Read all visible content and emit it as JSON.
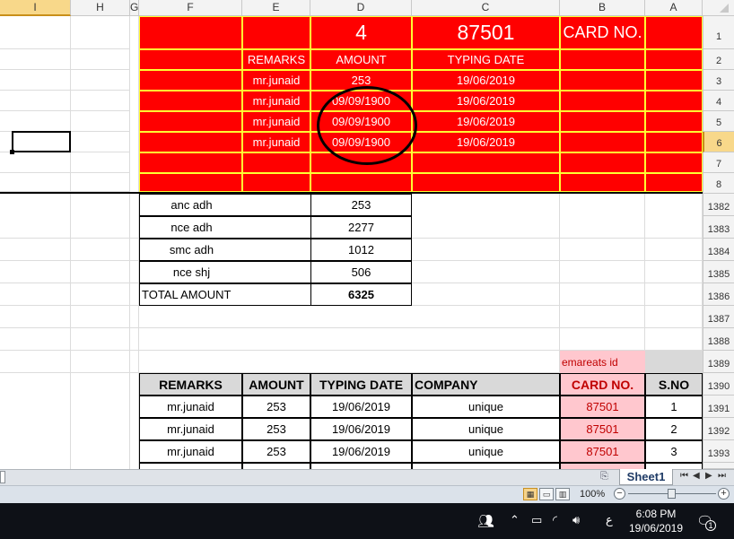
{
  "columns": {
    "i": "I",
    "h": "H",
    "g": "G",
    "f": "F",
    "e": "E",
    "d": "D",
    "c": "C",
    "b": "B",
    "a": "A"
  },
  "rows": [
    "1",
    "2",
    "3",
    "4",
    "5",
    "6",
    "7",
    "8",
    "1382",
    "1383",
    "1384",
    "1385",
    "1386",
    "1387",
    "1388",
    "1389",
    "1390",
    "1391",
    "1392",
    "1393"
  ],
  "header_block": {
    "row1": {
      "count": "4",
      "card": "87501",
      "card_label": "CARD NO."
    },
    "row2": {
      "remarks": "REMARKS",
      "amount": "AMOUNT",
      "typing_date": "TYPING DATE"
    },
    "rows": [
      {
        "remarks": "mr.junaid",
        "amount": "253",
        "date": "19/06/2019"
      },
      {
        "remarks": "mr.junaid",
        "amount": "09/09/1900",
        "date": "19/06/2019"
      },
      {
        "remarks": "mr.junaid",
        "amount": "09/09/1900",
        "date": "19/06/2019"
      },
      {
        "remarks": "mr.junaid",
        "amount": "09/09/1900",
        "date": "19/06/2019"
      }
    ]
  },
  "summary": [
    {
      "label": "anc adh",
      "value": "253"
    },
    {
      "label": "nce adh",
      "value": "2277"
    },
    {
      "label": "smc adh",
      "value": "1012"
    },
    {
      "label": "nce shj",
      "value": "506"
    }
  ],
  "total": {
    "label": "TOTAL AMOUNT",
    "value": "6325"
  },
  "emareats_label": "emareats id",
  "table": {
    "headers": [
      "REMARKS",
      "AMOUNT",
      "TYPING DATE",
      "COMPANY",
      "CARD NO.",
      "S.NO"
    ],
    "rows": [
      [
        "mr.junaid",
        "253",
        "19/06/2019",
        "unique",
        "87501",
        "1"
      ],
      [
        "mr.junaid",
        "253",
        "19/06/2019",
        "unique",
        "87501",
        "2"
      ],
      [
        "mr.junaid",
        "253",
        "19/06/2019",
        "unique",
        "87501",
        "3"
      ]
    ]
  },
  "sheet_tab": "Sheet1",
  "zoom": "100%",
  "taskbar": {
    "time": "6:08 PM",
    "date": "19/06/2019",
    "lang": "ع",
    "notifications": "1"
  },
  "colors": {
    "red_fill": "#ff0000",
    "yellow_border": "#ffff33",
    "pink_fill": "#ffc7ce",
    "header_gray": "#d9d9d9",
    "selected_header": "#f8d88a"
  }
}
